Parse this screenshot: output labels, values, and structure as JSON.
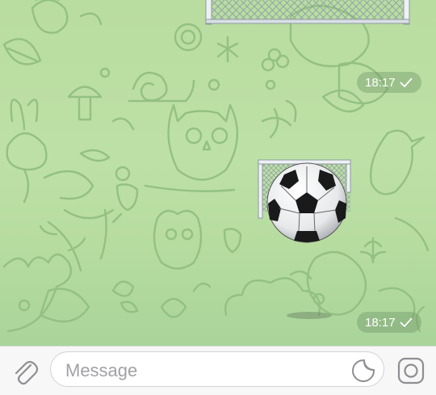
{
  "messages": [
    {
      "type": "sticker",
      "sticker": "soccer-goal",
      "time": "18:17",
      "status": "read-check"
    },
    {
      "type": "sticker",
      "sticker": "soccer-ball-goal",
      "time": "18:17",
      "status": "read-check"
    }
  ],
  "composer": {
    "placeholder": "Message",
    "icons": [
      "paperclip-icon",
      "sticker-icon",
      "camera-icon"
    ]
  },
  "colors": {
    "wallpaper": "#b9dca0",
    "doodle": "#93c083",
    "time_badge": "#7a9a6e",
    "bar": "#f7f7f7",
    "icon": "#8e8e93"
  }
}
